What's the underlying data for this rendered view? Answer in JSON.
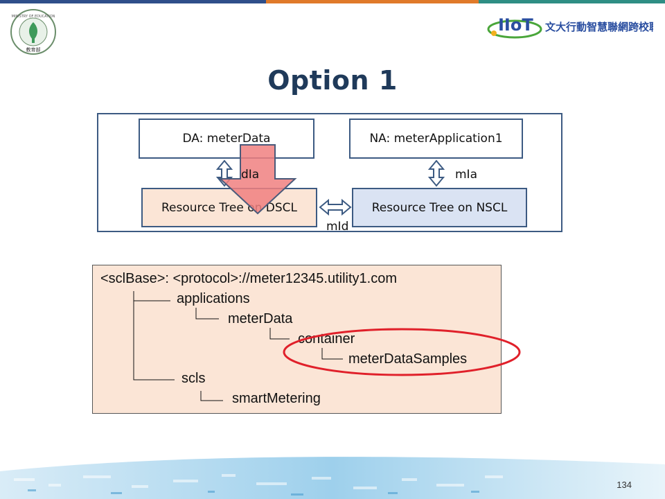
{
  "slide": {
    "title": "Option 1",
    "page_number": "134"
  },
  "logos": {
    "left_seal_top": "MINISTRY OF EDUCATION",
    "left_seal_bottom": "教育部",
    "right_brand": "IIoT",
    "right_text": "文大行動智慧聯網跨校聯盟"
  },
  "diagram": {
    "da_box": "DA: meterData",
    "na_box": "NA: meterApplication1",
    "dscl_box": "Resource Tree on DSCL",
    "nscl_box": "Resource Tree on NSCL",
    "dia_label": "dIa",
    "mia_label": "mIa",
    "mid_label": "mId"
  },
  "tree": {
    "root": "<sclBase>: <protocol>://meter12345.utility1.com",
    "applications": "applications",
    "meterData": "meterData",
    "container": "container",
    "meterDataSamples": "meterDataSamples",
    "scls": "scls",
    "smartMetering": "smartMetering"
  },
  "colors": {
    "frame": "#3c5a82",
    "peach": "#fbe5d6",
    "blue_box": "#dae3f3",
    "highlight_arrow": "#f08080",
    "highlight_ellipse": "#e0202a"
  }
}
